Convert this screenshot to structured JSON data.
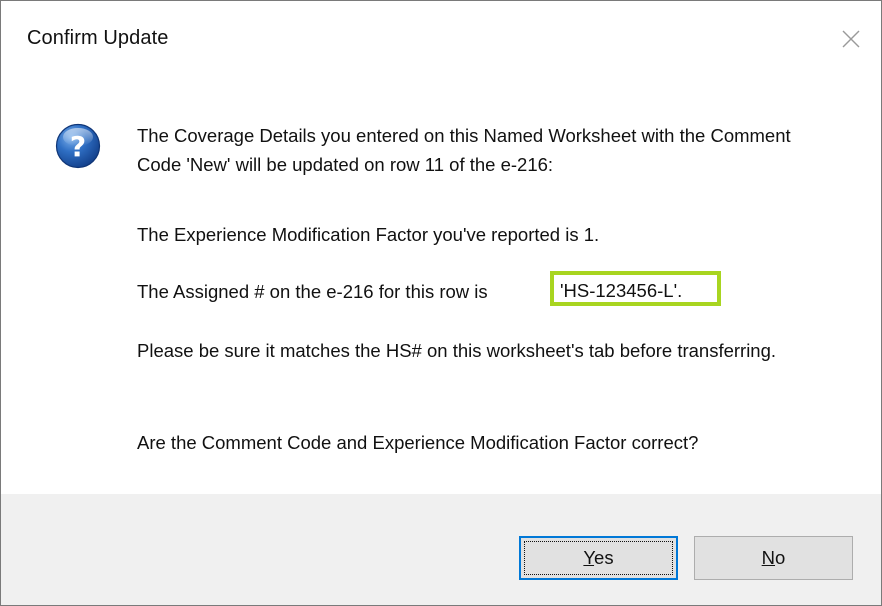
{
  "dialog": {
    "title": "Confirm Update",
    "icon": "question-icon",
    "messages": {
      "line1": "The Coverage Details you entered on this Named Worksheet with the Comment Code 'New' will be updated on row 11 of the e-216:",
      "line2": "The Experience Modification Factor you've reported is 1.",
      "line3_prefix": "The Assigned # on the e-216 for this row is",
      "line3_value": "'HS-123456-L'.",
      "line4": "Please be sure it matches the HS# on this worksheet's tab before transferring.",
      "line5": "Are the Comment Code and Experience Modification Factor correct?"
    },
    "buttons": {
      "yes_accel": "Y",
      "yes_rest": "es",
      "no_accel": "N",
      "no_rest": "o"
    },
    "colors": {
      "highlight_border": "#a8d520",
      "focus_border": "#0078d7",
      "footer_bg": "#f0f0f0"
    }
  }
}
